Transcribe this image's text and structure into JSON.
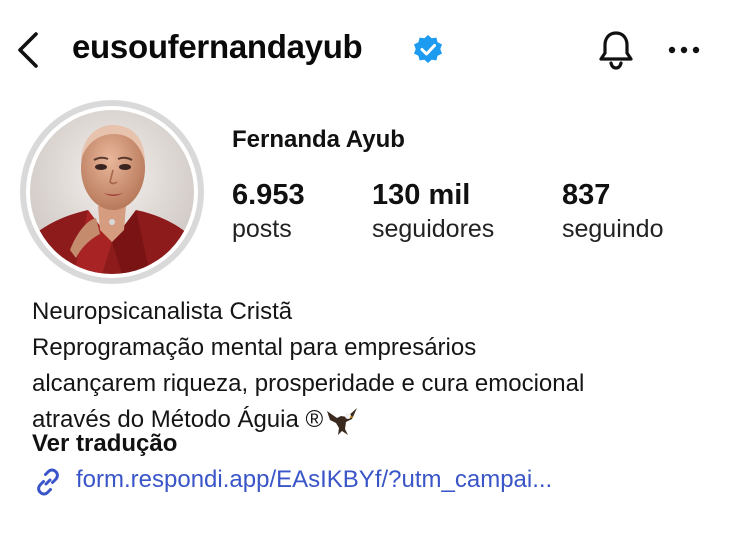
{
  "header": {
    "username": "eusoufernandayub",
    "icons": {
      "back": "chevron-left-icon",
      "verified": "verified-badge-icon",
      "notifications": "bell-icon",
      "more": "more-horizontal-icon"
    },
    "verified_color": "#1d9bf0"
  },
  "profile": {
    "display_name": "Fernanda Ayub",
    "stats": [
      {
        "value": "6.953",
        "label": "posts"
      },
      {
        "value": "130 mil",
        "label": "seguidores"
      },
      {
        "value": "837",
        "label": "seguindo"
      }
    ]
  },
  "bio": {
    "lines": [
      "Neuropsicanalista Cristã",
      "Reprogramação mental para empresários",
      "alcançarem riqueza, prosperidade e cura emocional",
      "através do Método Águia ®"
    ],
    "emoji": "eagle-icon",
    "translate_label": "Ver tradução",
    "link": {
      "text": "form.respondi.app/EAsIKBYf/?utm_campai...",
      "icon": "link-icon",
      "color": "#3a55c8"
    }
  }
}
